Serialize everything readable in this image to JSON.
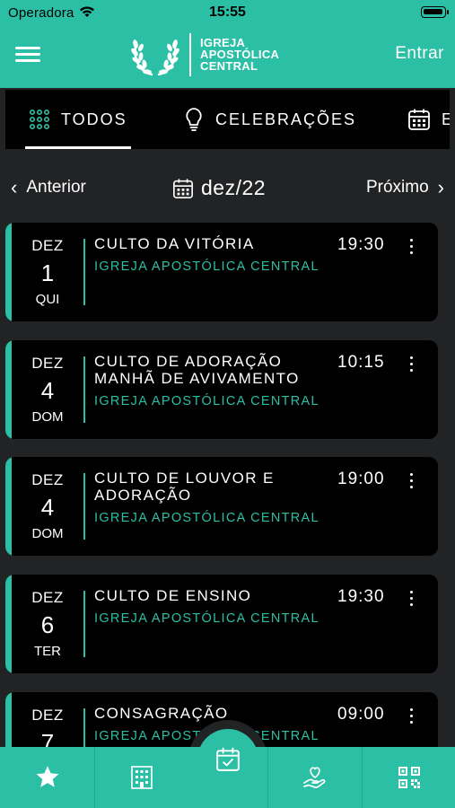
{
  "status_bar": {
    "carrier": "Operadora",
    "time": "15:55"
  },
  "header": {
    "brand_lines": [
      "IGREJA",
      "APOSTÓLICA",
      "CENTRAL"
    ],
    "login_label": "Entrar"
  },
  "tabs": [
    {
      "label": "TODOS",
      "icon": "grid-dots-icon"
    },
    {
      "label": "CELEBRAÇÕES",
      "icon": "lightbulb-icon"
    },
    {
      "label": "E",
      "icon": "calendar-icon"
    }
  ],
  "month_nav": {
    "prev_label": "Anterior",
    "current": "dez/22",
    "next_label": "Próximo"
  },
  "events": [
    {
      "month": "DEZ",
      "day": "1",
      "weekday": "QUI",
      "title": "CULTO DA VITÓRIA",
      "church": "IGREJA APOSTÓLICA CENTRAL",
      "time": "19:30"
    },
    {
      "month": "DEZ",
      "day": "4",
      "weekday": "DOM",
      "title": "CULTO DE ADORAÇÃO MANHÃ DE AVIVAMENTO",
      "church": "IGREJA APOSTÓLICA CENTRAL",
      "time": "10:15"
    },
    {
      "month": "DEZ",
      "day": "4",
      "weekday": "DOM",
      "title": "CULTO DE LOUVOR E ADORAÇÃO",
      "church": "IGREJA APOSTÓLICA CENTRAL",
      "time": "19:00"
    },
    {
      "month": "DEZ",
      "day": "6",
      "weekday": "TER",
      "title": "CULTO DE ENSINO",
      "church": "IGREJA APOSTÓLICA CENTRAL",
      "time": "19:30"
    },
    {
      "month": "DEZ",
      "day": "7",
      "weekday": "",
      "title": "CONSAGRAÇÃO",
      "church": "IGREJA APOSTÓLICA CENTRAL",
      "time": "09:00"
    }
  ],
  "bottom_nav": [
    {
      "icon": "star-icon"
    },
    {
      "icon": "building-icon"
    },
    {
      "icon": "calendar-check-icon"
    },
    {
      "icon": "heart-hand-icon"
    },
    {
      "icon": "qr-code-icon"
    }
  ],
  "colors": {
    "accent": "#2bbfa5",
    "background": "#222325",
    "card": "#000000"
  }
}
